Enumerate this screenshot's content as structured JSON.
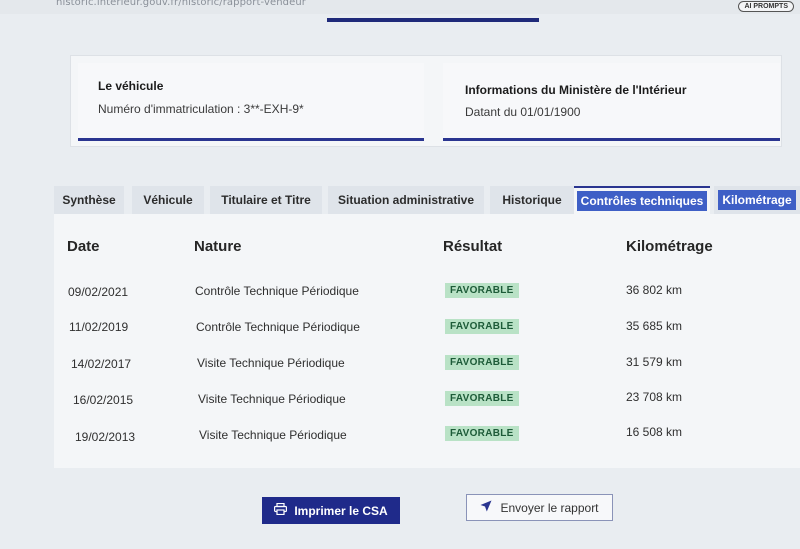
{
  "browser": {
    "url": "historic.interieur.gouv.fr/historic/rapport-vendeur",
    "chip_label": "AI PROMPTS"
  },
  "vehicle_card": {
    "title": "Le véhicule",
    "text": "Numéro d'immatriculation : 3**-EXH-9*"
  },
  "ministry_card": {
    "title": "Informations du Ministère de l'Intérieur",
    "text": "Datant du 01/01/1900"
  },
  "tabs": [
    {
      "label": "Synthèse"
    },
    {
      "label": "Véhicule"
    },
    {
      "label": "Titulaire et Titre"
    },
    {
      "label": "Situation administrative"
    },
    {
      "label": "Historique"
    },
    {
      "label": "Contrôles techniques"
    },
    {
      "label": "Kilométrage"
    }
  ],
  "table": {
    "headers": {
      "date": "Date",
      "nature": "Nature",
      "result": "Résultat",
      "mileage": "Kilométrage"
    },
    "rows": [
      {
        "date": "09/02/2021",
        "nature": "Contrôle Technique Périodique",
        "result": "FAVORABLE",
        "mileage": "36 802 km"
      },
      {
        "date": "11/02/2019",
        "nature": "Contrôle Technique Périodique",
        "result": "FAVORABLE",
        "mileage": "35 685 km"
      },
      {
        "date": "14/02/2017",
        "nature": "Visite Technique Périodique",
        "result": "FAVORABLE",
        "mileage": "31 579 km"
      },
      {
        "date": "16/02/2015",
        "nature": "Visite Technique Périodique",
        "result": "FAVORABLE",
        "mileage": "23 708 km"
      },
      {
        "date": "19/02/2013",
        "nature": "Visite Technique Périodique",
        "result": "FAVORABLE",
        "mileage": "16 508 km"
      }
    ]
  },
  "actions": {
    "print_label": "Imprimer le CSA",
    "send_label": "Envoyer le rapport"
  },
  "colors": {
    "accent": "#1f2a8a",
    "badge_bg": "#b9e2c6",
    "badge_text": "#1d5b38"
  }
}
